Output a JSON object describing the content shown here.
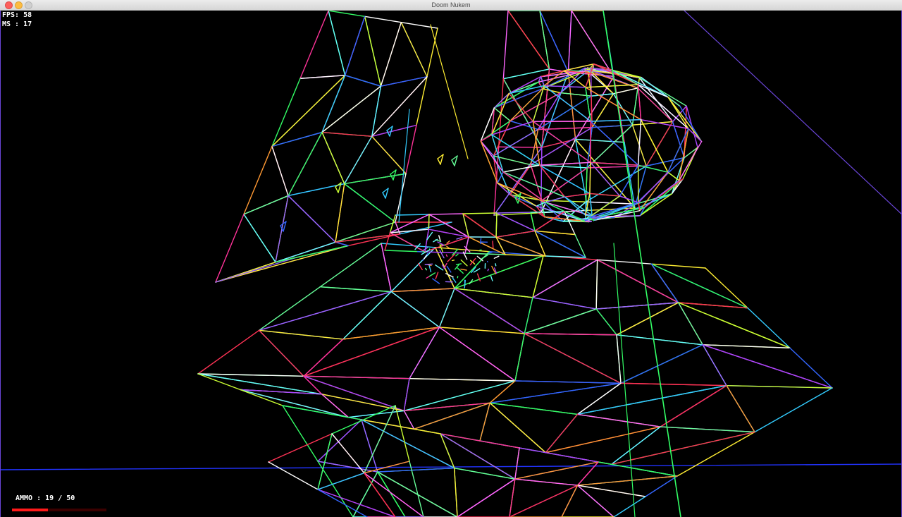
{
  "window": {
    "title": "Doom Nukem"
  },
  "hud": {
    "fps_text": "FPS: 58",
    "ms_text": "MS : 17",
    "ammo_text": "AMMO : 19 / 50",
    "ammo_current": 19,
    "ammo_max": 50
  },
  "colors": {
    "ammo_bar": "#ff1a1a",
    "frame_border": "#6a45d8",
    "floor_line": "#2233ff"
  }
}
